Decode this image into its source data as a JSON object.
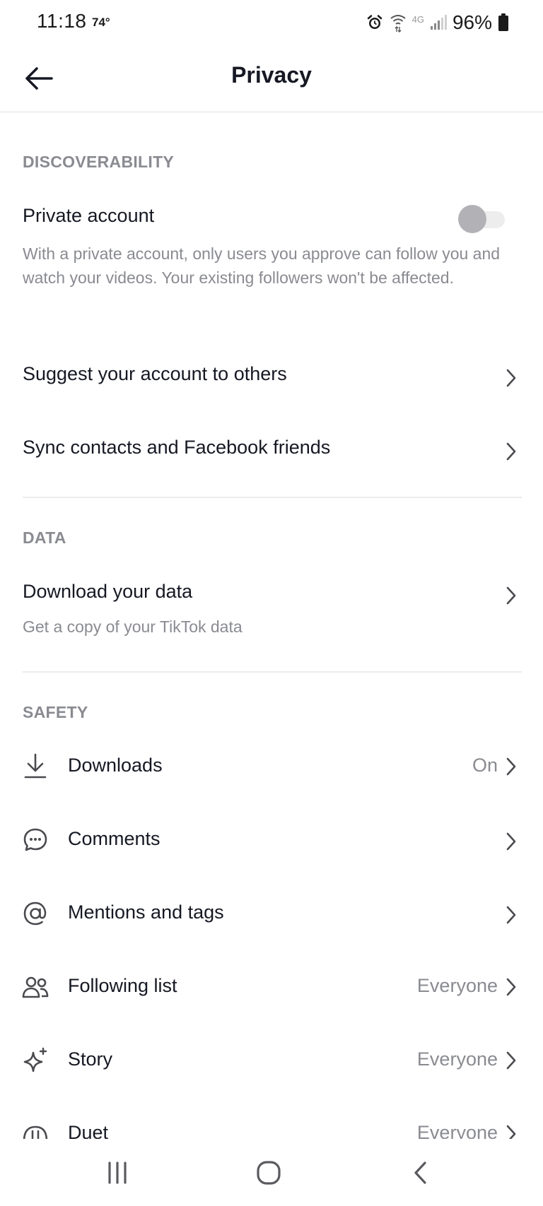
{
  "status_bar": {
    "time": "11:18",
    "temperature": "74°",
    "network": "4G",
    "battery": "96%"
  },
  "header": {
    "title": "Privacy"
  },
  "discoverability": {
    "header": "DISCOVERABILITY",
    "private_account": {
      "label": "Private account",
      "description": "With a private account, only users you approve can follow you and watch your videos. Your existing followers won't be affected.",
      "enabled": false
    },
    "suggest": {
      "label": "Suggest your account to others"
    },
    "sync": {
      "label": "Sync contacts and Facebook friends"
    }
  },
  "data": {
    "header": "DATA",
    "download": {
      "label": "Download your data",
      "description": "Get a copy of your TikTok data"
    }
  },
  "safety": {
    "header": "SAFETY",
    "items": [
      {
        "label": "Downloads",
        "value": "On",
        "icon": "download-icon"
      },
      {
        "label": "Comments",
        "value": "",
        "icon": "comment-icon"
      },
      {
        "label": "Mentions and tags",
        "value": "",
        "icon": "at-icon"
      },
      {
        "label": "Following list",
        "value": "Everyone",
        "icon": "people-icon"
      },
      {
        "label": "Story",
        "value": "Everyone",
        "icon": "sparkle-icon"
      },
      {
        "label": "Duet",
        "value": "Everyone",
        "icon": "duet-icon"
      }
    ]
  },
  "colors": {
    "text_primary": "#161823",
    "text_secondary": "#8a8b91",
    "toggle_off": "#b2b2b6"
  }
}
